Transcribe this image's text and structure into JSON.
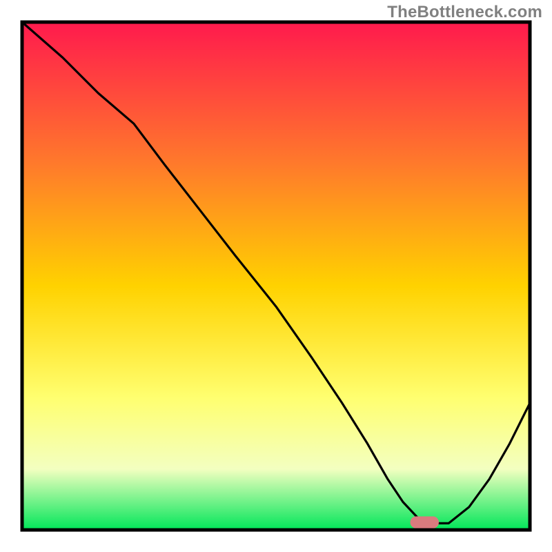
{
  "watermark": "TheBottleneck.com",
  "colors": {
    "gradient_top": "#ff1a4d",
    "gradient_mid_upper": "#ff7a2b",
    "gradient_mid": "#ffd200",
    "gradient_mid_lower": "#ffff70",
    "gradient_lower": "#f3ffc0",
    "gradient_bottom": "#00e659",
    "frame": "#000000",
    "curve": "#000000",
    "marker_fill": "#d97b7e",
    "marker_stroke": "#d97b7e"
  },
  "chart_data": {
    "type": "line",
    "title": "",
    "xlabel": "",
    "ylabel": "",
    "xlim": [
      0,
      100
    ],
    "ylim": [
      0,
      100
    ],
    "series": [
      {
        "name": "bottleneck-curve",
        "x": [
          0,
          8,
          15,
          22,
          28,
          35,
          42,
          50,
          57,
          63,
          68,
          72,
          75,
          78,
          80.5,
          84,
          88,
          92,
          96,
          100
        ],
        "y": [
          100,
          93,
          86,
          80,
          72,
          63,
          54,
          44,
          34,
          25,
          17,
          10,
          5.5,
          2.3,
          1.3,
          1.3,
          4.5,
          10,
          17,
          25
        ]
      }
    ],
    "marker": {
      "x_start": 76.5,
      "x_end": 82,
      "y": 1.5,
      "height": 2.2
    },
    "annotations": []
  }
}
